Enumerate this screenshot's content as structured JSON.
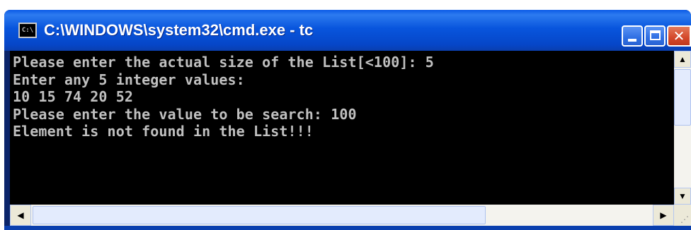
{
  "window": {
    "title": "C:\\WINDOWS\\system32\\cmd.exe - tc",
    "icon_label": "C:\\",
    "icon": "console-icon",
    "buttons": {
      "minimize": "minimize-icon",
      "maximize": "maximize-icon",
      "close": "close-icon",
      "close_glyph": "✕"
    }
  },
  "console": {
    "lines": [
      "Please enter the actual size of the List[<100]: 5",
      "Enter any 5 integer values:",
      "10 15 74 20 52",
      "Please enter the value to be search: 100",
      "Element is not found in the List!!!"
    ]
  },
  "scrollbars": {
    "up_arrow": "▲",
    "down_arrow": "▼",
    "left_arrow": "◀",
    "right_arrow": "▶",
    "grip": "⋰"
  },
  "colors": {
    "console_bg": "#000000",
    "console_text": "#c0c0c0",
    "titlebar": "#0855dd",
    "close_button": "#d4482a"
  }
}
